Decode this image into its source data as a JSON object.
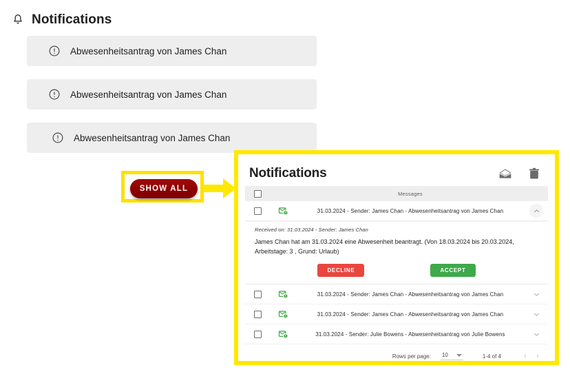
{
  "page": {
    "title": "Notifications",
    "bell_icon": "bell-icon",
    "notifications": [
      {
        "icon": "exclamation-circle-icon",
        "text": "Abwesenheitsantrag von James Chan"
      },
      {
        "icon": "exclamation-circle-icon",
        "text": "Abwesenheitsantrag von James Chan"
      },
      {
        "icon": "exclamation-circle-icon",
        "text": "Abwesenheitsantrag von James Chan"
      }
    ],
    "show_all_button": "SHOW ALL"
  },
  "panel": {
    "title": "Notifications",
    "actions": [
      {
        "name": "mark-as-read-icon",
        "label": "mail-open-icon"
      },
      {
        "name": "delete-icon",
        "label": "trash-icon"
      }
    ],
    "table": {
      "header": {
        "select_all": "select-all-checkbox",
        "messages_column": "Messages"
      },
      "rows": [
        {
          "icon": "mail-unread-icon",
          "message": "31.03.2024 - Sender: James Chan - Abwesenheitsantrag von James Chan",
          "expanded": true,
          "chevron": "chevron-up-icon"
        },
        {
          "icon": "mail-unread-icon",
          "message": "31.03.2024 - Sender: James Chan - Abwesenheitsantrag von James Chan",
          "expanded": false,
          "chevron": "chevron-down-icon"
        },
        {
          "icon": "mail-unread-icon",
          "message": "31.03.2024 - Sender: James Chan - Abwesenheitsantrag von James Chan",
          "expanded": false,
          "chevron": "chevron-down-icon"
        },
        {
          "icon": "mail-unread-icon",
          "message": "31.03.2024 - Sender: Julie Bowens - Abwesenheitsantrag von Julie Bowens",
          "expanded": false,
          "chevron": "chevron-down-icon"
        }
      ]
    },
    "detail": {
      "meta": "Received on: 31.03.2024 - Sender: James Chan",
      "body": "James Chan hat am 31.03.2024 eine Abwesenheit beantragt. (Von 18.03.2024 bis 20.03.2024, Arbeitstage: 3 , Grund: Urlaub)",
      "decline_label": "DECLINE",
      "accept_label": "ACCEPT"
    },
    "pagination": {
      "rows_per_page_label": "Rows per page:",
      "rows_per_page_value": "10",
      "range": "1-4 of 4",
      "prev": "‹",
      "next": "›"
    }
  },
  "colors": {
    "highlight": "#ffe800",
    "show_all_bg": "#8d0000",
    "decline": "#e8473f",
    "accept": "#3fa94b",
    "card_bg": "#eeeeee",
    "mail_icon_green": "#4caf50"
  }
}
